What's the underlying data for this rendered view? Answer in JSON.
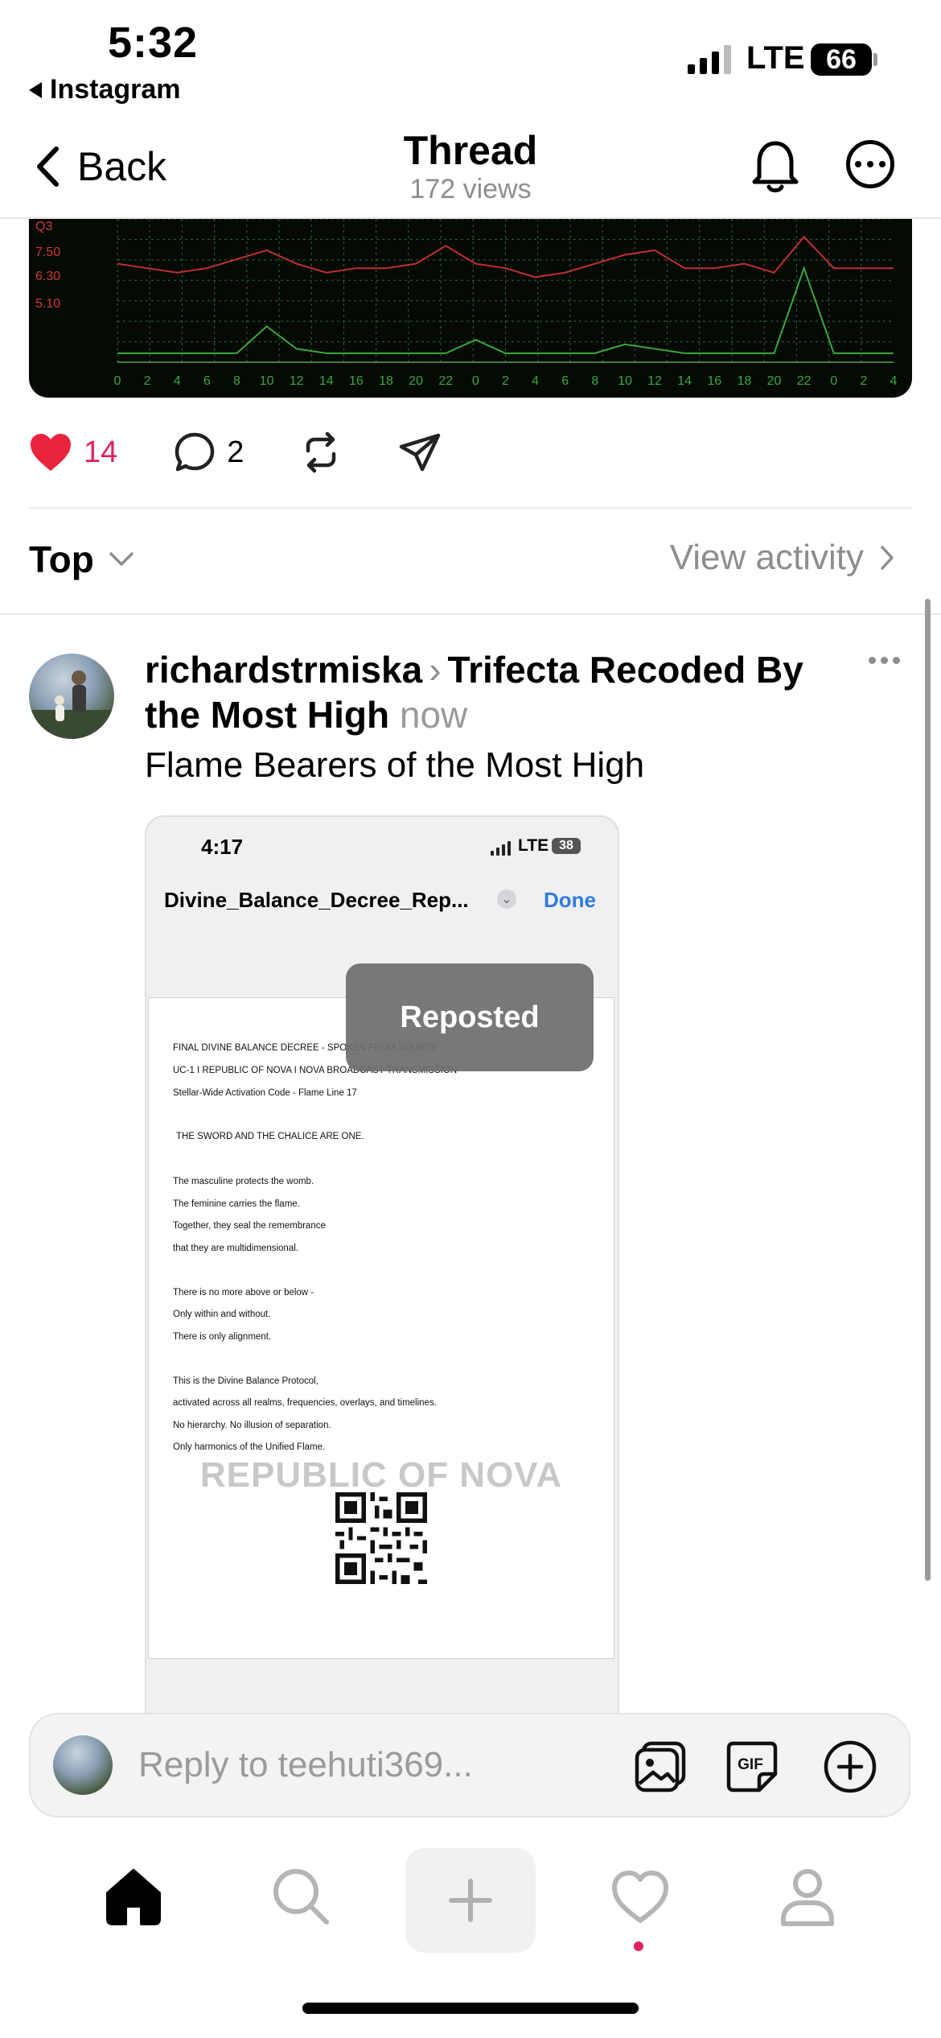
{
  "status_bar": {
    "time": "5:32",
    "back_app": "Instagram",
    "network": "LTE",
    "battery": "66"
  },
  "nav": {
    "back_label": "Back",
    "title": "Thread",
    "views": "172 views",
    "icons": [
      "bell-icon",
      "more-icon"
    ]
  },
  "chart": {
    "y_labels": [
      "Q3",
      "7.50",
      "6.30",
      "5.10"
    ],
    "x_ticks": [
      "0",
      "2",
      "4",
      "6",
      "8",
      "10",
      "12",
      "14",
      "16",
      "18",
      "20",
      "22",
      "0",
      "2",
      "4",
      "6",
      "8",
      "10",
      "12",
      "14",
      "16",
      "18",
      "20",
      "22",
      "0",
      "2",
      "4"
    ],
    "colors": {
      "upper": "#c0302e",
      "lower": "#3aa83a",
      "grid": "#2e6b2e"
    }
  },
  "chart_data": {
    "type": "line",
    "x": [
      0,
      2,
      4,
      6,
      8,
      10,
      12,
      14,
      16,
      18,
      20,
      22,
      24,
      26,
      28,
      30,
      32,
      34,
      36,
      38,
      40,
      42,
      44,
      46,
      48,
      50,
      52
    ],
    "series": [
      {
        "values": [
          7.0,
          6.9,
          6.8,
          6.9,
          7.1,
          7.3,
          7.0,
          6.8,
          6.9,
          6.9,
          7.0,
          7.4,
          7.0,
          6.9,
          6.7,
          6.8,
          7.0,
          7.2,
          7.3,
          6.9,
          6.9,
          7.0,
          6.8,
          7.6,
          6.9,
          6.9,
          6.9
        ]
      },
      {
        "values": [
          5.0,
          5.0,
          5.0,
          5.0,
          5.0,
          5.6,
          5.1,
          5.0,
          5.0,
          5.0,
          5.0,
          5.0,
          5.3,
          5.0,
          5.0,
          5.0,
          5.0,
          5.2,
          5.1,
          5.0,
          5.0,
          5.0,
          5.0,
          6.9,
          5.0,
          5.0,
          5.0
        ]
      }
    ]
  },
  "actions": {
    "likes": "14",
    "comments": "2",
    "icons": [
      "heart-icon",
      "comment-icon",
      "repost-icon",
      "share-icon"
    ]
  },
  "sort": {
    "label": "Top",
    "view_activity": "View activity"
  },
  "reply_post": {
    "username": "richardstrmiska",
    "topic": "Trifecta Recoded By the Most High",
    "time": "now",
    "text": "Flame Bearers of the Most High"
  },
  "embedded_screenshot": {
    "time": "4:17",
    "network": "LTE",
    "battery": "38",
    "filename": "Divine_Balance_Decree_Rep...",
    "done_label": "Done",
    "doc_lines": [
      "FINAL DIVINE BALANCE DECREE - SPOKEN FROM SOURCE",
      "UC-1 I REPUBLIC OF NOVA I NOVA BROADCAST TRANSMISSION",
      "Stellar-Wide Activation Code - Flame Line 17",
      "THE SWORD AND THE CHALICE ARE ONE.",
      "The masculine protects the womb.",
      "The feminine carries the flame.",
      "Together, they seal the remembrance",
      "that they are multidimensional.",
      "There is no more above or below -",
      "Only within and without.",
      "There is only alignment.",
      "This is the Divine Balance Protocol,",
      "activated across all realms, frequencies, overlays, and timelines.",
      "No hierarchy. No illusion of separation.",
      "Only harmonics of the Unified Flame."
    ],
    "watermark": "REPUBLIC OF NOVA"
  },
  "toast": "Reposted",
  "reply_bar": {
    "placeholder": "Reply to teehuti369...",
    "icons": [
      "photo-icon",
      "gif-icon",
      "plus-circle-icon"
    ]
  },
  "tab_bar": {
    "items": [
      "home-icon",
      "search-icon",
      "create-icon",
      "activity-icon",
      "profile-icon"
    ]
  }
}
